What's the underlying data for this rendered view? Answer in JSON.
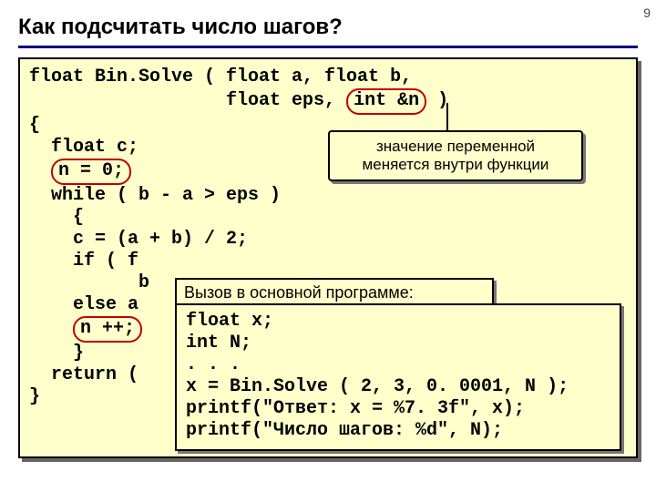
{
  "page_number": "9",
  "title": "Как подсчитать число шагов?",
  "main": {
    "l1a": "float Bin.Solve ( float a, float b,",
    "l2a": "                  float eps, ",
    "l2b_circ": "int &n",
    "l2c": " )",
    "l3": "{",
    "l4": "  float c;",
    "l5a": "  ",
    "l5b_circ": "n = 0;",
    "l6": "  while ( b - a > eps )",
    "l7": "    {",
    "l8": "    c = (a + b) / 2;",
    "l9": "    if ( f",
    "l10": "          b",
    "l11": "    else a",
    "l12a": "    ",
    "l12b_circ": "n ++;",
    "l13": "    }",
    "l14": "  return (",
    "l15": "}"
  },
  "callout1_line1": "значение переменной",
  "callout1_line2": "меняется внутри функции",
  "callout2_title": "Вызов в основной программе:",
  "callout2": {
    "l1": "float x;",
    "l2": "int N;",
    "l3": ". . .",
    "l4": "x = Bin.Solve ( 2, 3, 0. 0001, N );",
    "l5": "printf(\"Ответ: x = %7. 3f\", x);",
    "l6": "printf(\"Число шагов: %d\", N);"
  }
}
